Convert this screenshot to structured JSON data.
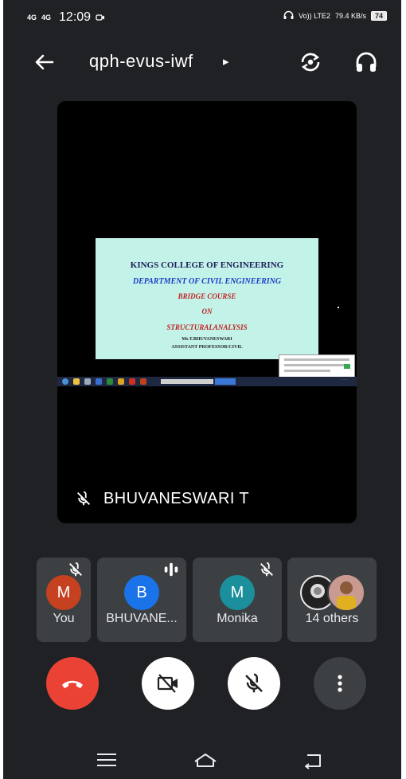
{
  "status_bar": {
    "net1": "4G",
    "net2": "4G",
    "time": "12:09",
    "volte": "Vo)) LTE2",
    "speed": "79.4 KB/s",
    "battery": "74"
  },
  "header": {
    "meeting_code": "qph-evus-iwf",
    "caret": "▸"
  },
  "presentation": {
    "line1": "KINGS COLLEGE OF ENGINEERING",
    "line2": "DEPARTMENT OF CIVIL ENGINEERING",
    "line3": "BRIDGE COURSE",
    "line4": "ON",
    "line5": "STRUCTURALANALYSIS",
    "line6": "Ms.T.BHUVANESWARI",
    "line7": "ASSISTANT PROFESSOR/CIVIL",
    "slide_bg": "#c3f3e8"
  },
  "speaker": {
    "name": "BHUVANESWARI T",
    "muted": true
  },
  "participants": [
    {
      "initial": "M",
      "name": "You",
      "muted": true,
      "avatar_color": "#c5411f"
    },
    {
      "initial": "B",
      "name": "BHUVANE...",
      "muted": false,
      "speaking": true,
      "avatar_color": "#1a73e8"
    },
    {
      "initial": "M",
      "name": "Monika",
      "muted": true,
      "avatar_color": "#1b8f9b"
    },
    {
      "initial": "",
      "name": "14 others",
      "muted": false
    }
  ],
  "controls": {
    "end_call_color": "#ea4335",
    "camera_off": true,
    "mic_off": true
  },
  "colors": {
    "background": "#202124",
    "tile": "#3c4043",
    "stage": "#000000"
  }
}
